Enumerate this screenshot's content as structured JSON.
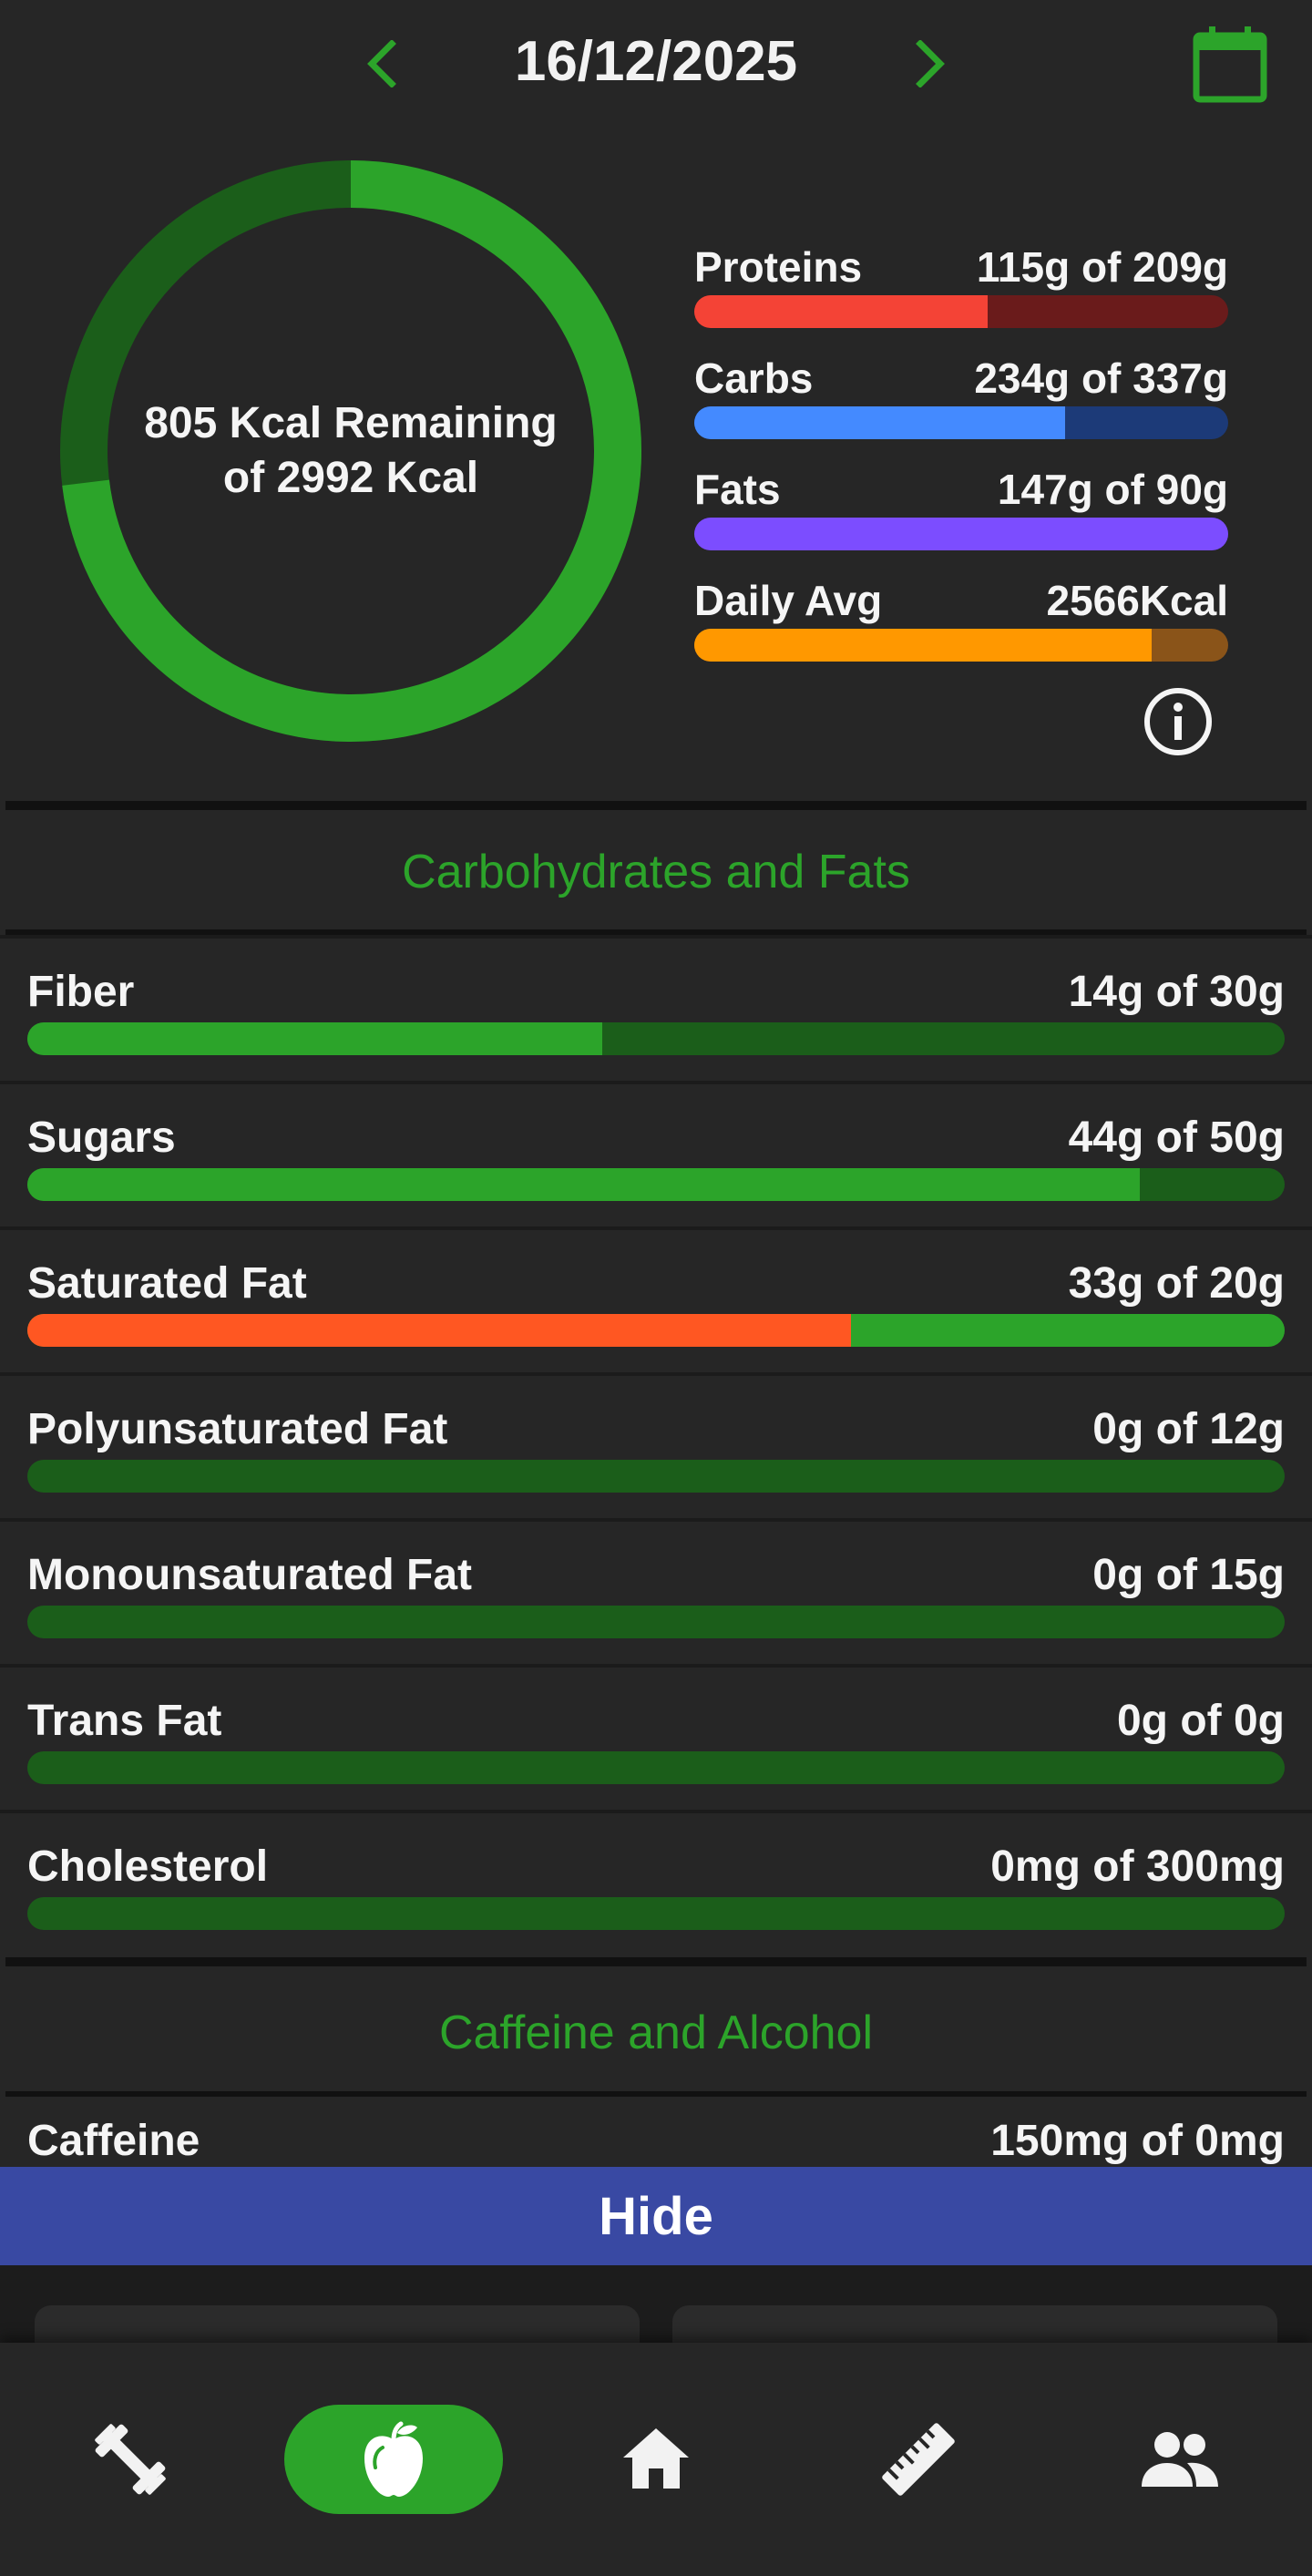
{
  "header": {
    "date": "16/12/2025",
    "prev_icon": "chevron-left-icon",
    "next_icon": "chevron-right-icon",
    "calendar_icon": "calendar-icon",
    "accent_color": "#2ca42a"
  },
  "summary": {
    "ring_line1": "805 Kcal Remaining",
    "ring_line2": "of 2992 Kcal",
    "ring_consumed_fraction": 0.731,
    "ring_colors": {
      "consumed": "#2ca42a",
      "remaining": "#1b5e1a"
    },
    "macros": [
      {
        "label": "Proteins",
        "value": "115g of 209g",
        "fraction": 0.55,
        "fill_color": "#f44336",
        "track_color": "#6a1b1b"
      },
      {
        "label": "Carbs",
        "value": "234g of 337g",
        "fraction": 0.694,
        "fill_color": "#448aff",
        "track_color": "#1c3a78"
      },
      {
        "label": "Fats",
        "value": "147g of 90g",
        "fraction": 1.0,
        "fill_color": "#7c4dff",
        "track_color": "#3b2478"
      },
      {
        "label": "Daily Avg",
        "value": "2566Kcal",
        "fraction": 0.857,
        "fill_color": "#ff9800",
        "track_color": "#8a5419"
      }
    ],
    "info_icon": "info-icon"
  },
  "carbs_fats": {
    "title": "Carbohydrates and Fats",
    "items": [
      {
        "label": "Fiber",
        "value": "14g of 30g",
        "fraction": 0.457,
        "over": false
      },
      {
        "label": "Sugars",
        "value": "44g of 50g",
        "fraction": 0.885,
        "over": false
      },
      {
        "label": "Saturated Fat",
        "value": "33g of 20g",
        "fraction": 0.655,
        "over": true
      },
      {
        "label": "Polyunsaturated Fat",
        "value": "0g of 12g",
        "fraction": 0,
        "over": false
      },
      {
        "label": "Monounsaturated Fat",
        "value": "0g of 15g",
        "fraction": 0,
        "over": false
      },
      {
        "label": "Trans Fat",
        "value": "0g of 0g",
        "fraction": 0,
        "over": false
      },
      {
        "label": "Cholesterol",
        "value": "0mg of 300mg",
        "fraction": 0,
        "over": false
      }
    ],
    "colors": {
      "fill": "#2ca42a",
      "track": "#1b5e1a",
      "over": "#ff5722"
    }
  },
  "caffeine_alcohol": {
    "title": "Caffeine and Alcohol",
    "items": [
      {
        "label": "Caffeine",
        "value": "150mg of 0mg"
      }
    ]
  },
  "hide_button": {
    "label": "Hide",
    "color": "#3949a3"
  },
  "bottom_nav": {
    "items": [
      {
        "icon": "dumbbell-icon",
        "active": false
      },
      {
        "icon": "apple-icon",
        "active": true
      },
      {
        "icon": "home-icon",
        "active": false
      },
      {
        "icon": "ruler-icon",
        "active": false
      },
      {
        "icon": "people-icon",
        "active": false
      }
    ]
  }
}
